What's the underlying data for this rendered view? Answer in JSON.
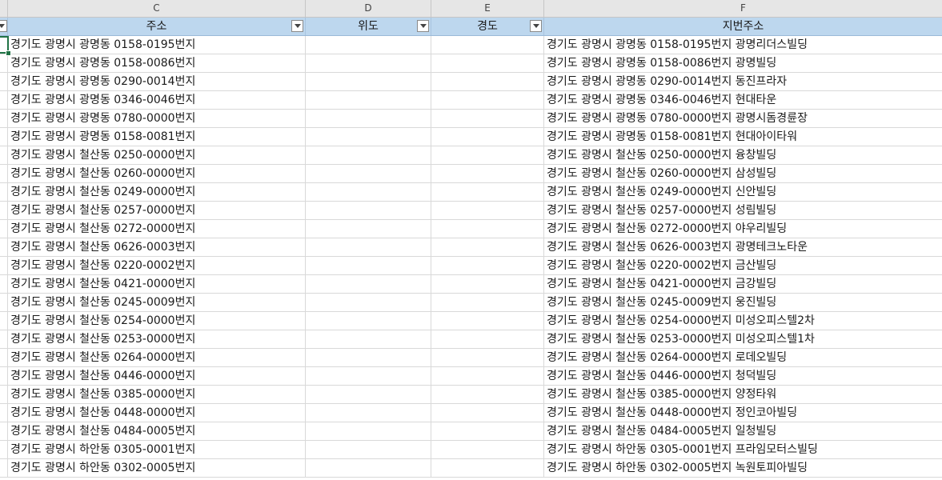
{
  "column_letters": {
    "c": "C",
    "d": "D",
    "e": "E",
    "f": "F"
  },
  "header": {
    "c": "주소",
    "d": "위도",
    "e": "경도",
    "f": "지번주소"
  },
  "rows": [
    {
      "c": "경기도 광명시 광명동 0158-0195번지",
      "f": "경기도 광명시 광명동 0158-0195번지 광명리더스빌딩"
    },
    {
      "c": "경기도 광명시 광명동 0158-0086번지",
      "f": "경기도 광명시 광명동 0158-0086번지 광명빌딩"
    },
    {
      "c": "경기도 광명시 광명동 0290-0014번지",
      "f": "경기도 광명시 광명동 0290-0014번지 동진프라자"
    },
    {
      "c": "경기도 광명시 광명동 0346-0046번지",
      "f": "경기도 광명시 광명동 0346-0046번지 현대타운"
    },
    {
      "c": "경기도 광명시 광명동 0780-0000번지",
      "f": "경기도 광명시 광명동 0780-0000번지 광명시돔경륜장"
    },
    {
      "c": "경기도 광명시 광명동 0158-0081번지",
      "f": "경기도 광명시 광명동 0158-0081번지 현대아이타워"
    },
    {
      "c": "경기도 광명시 철산동 0250-0000번지",
      "f": "경기도 광명시 철산동 0250-0000번지 융창빌딩"
    },
    {
      "c": "경기도 광명시 철산동 0260-0000번지",
      "f": "경기도 광명시 철산동 0260-0000번지 삼성빌딩"
    },
    {
      "c": "경기도 광명시 철산동 0249-0000번지",
      "f": "경기도 광명시 철산동 0249-0000번지 신안빌딩"
    },
    {
      "c": "경기도 광명시 철산동 0257-0000번지",
      "f": "경기도 광명시 철산동 0257-0000번지 성림빌딩"
    },
    {
      "c": "경기도 광명시 철산동 0272-0000번지",
      "f": "경기도 광명시 철산동 0272-0000번지 야우리빌딩"
    },
    {
      "c": "경기도 광명시 철산동 0626-0003번지",
      "f": "경기도 광명시 철산동 0626-0003번지 광명테크노타운"
    },
    {
      "c": "경기도 광명시 철산동 0220-0002번지",
      "f": "경기도 광명시 철산동 0220-0002번지 금산빌딩"
    },
    {
      "c": "경기도 광명시 철산동 0421-0000번지",
      "f": "경기도 광명시 철산동 0421-0000번지 금강빌딩"
    },
    {
      "c": "경기도 광명시 철산동 0245-0009번지",
      "f": "경기도 광명시 철산동 0245-0009번지 웅진빌딩"
    },
    {
      "c": "경기도 광명시 철산동 0254-0000번지",
      "f": "경기도 광명시 철산동 0254-0000번지 미성오피스텔2차"
    },
    {
      "c": "경기도 광명시 철산동 0253-0000번지",
      "f": "경기도 광명시 철산동 0253-0000번지 미성오피스텔1차"
    },
    {
      "c": "경기도 광명시 철산동 0264-0000번지",
      "f": "경기도 광명시 철산동 0264-0000번지 로데오빌딩"
    },
    {
      "c": "경기도 광명시 철산동 0446-0000번지",
      "f": "경기도 광명시 철산동 0446-0000번지 청덕빌딩"
    },
    {
      "c": "경기도 광명시 철산동 0385-0000번지",
      "f": "경기도 광명시 철산동 0385-0000번지 양정타워"
    },
    {
      "c": "경기도 광명시 철산동 0448-0000번지",
      "f": "경기도 광명시 철산동 0448-0000번지 정인코아빌딩"
    },
    {
      "c": "경기도 광명시 철산동 0484-0005번지",
      "f": "경기도 광명시 철산동 0484-0005번지 일청빌딩"
    },
    {
      "c": "경기도 광명시 하안동 0305-0001번지",
      "f": "경기도 광명시 하안동 0305-0001번지 프라임모터스빌딩"
    },
    {
      "c": "경기도 광명시 하안동 0302-0005번지",
      "f": "경기도 광명시 하안동 0302-0005번지 녹원토피아빌딩"
    }
  ],
  "icons": {
    "filter_button": "filter-dropdown-icon"
  },
  "colors": {
    "filter_header_bg": "#bdd7ee",
    "column_header_bg": "#e6e6e6",
    "active_cell_border": "#217346"
  }
}
